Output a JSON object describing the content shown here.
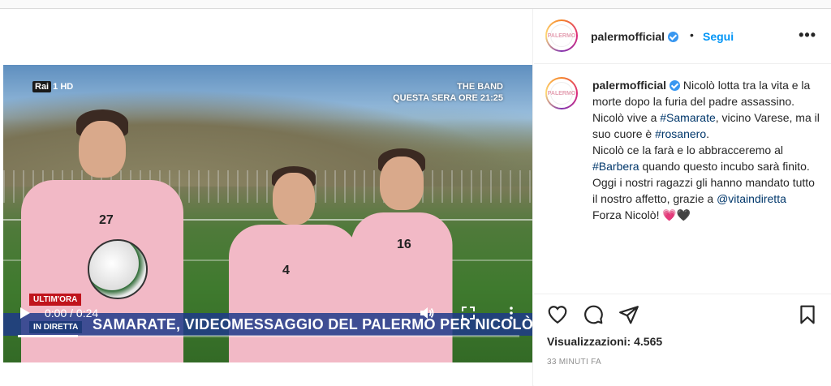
{
  "post": {
    "username": "palermofficial",
    "follow_label": "Segui",
    "separator": "•",
    "more_label": "•••",
    "avatar_text": "PALERMO"
  },
  "video": {
    "channel_logo": "Rai",
    "channel_num": "1",
    "channel_hd": "HD",
    "promo_line1": "THE BAND",
    "promo_line2": "QUESTA SERA ORE 21:25",
    "ticker_tag": "ULTIM'ORA",
    "ticker_live": "IN DIRETTA",
    "ticker_text": "SAMARATE, VIDEOMESSAGGIO DEL PALERMO PER NICOLÒ",
    "time_display": "0:00 / 0:24",
    "progress_fraction": 0.12,
    "player_numbers": [
      "27",
      "4",
      "16"
    ],
    "icons": [
      "play-icon",
      "volume-icon",
      "fullscreen-icon",
      "more-vertical-icon"
    ]
  },
  "caption": {
    "lines": [
      {
        "parts": [
          {
            "text": "Nicolò lotta tra la vita e la morte dopo la furia del padre assassino."
          }
        ]
      },
      {
        "parts": [
          {
            "text": "Nicolò vive a "
          },
          {
            "text": "#Samarate",
            "tag": true
          },
          {
            "text": ", vicino Varese, ma il suo cuore è "
          },
          {
            "text": "#rosanero",
            "tag": true
          },
          {
            "text": "."
          }
        ]
      },
      {
        "parts": [
          {
            "text": "Nicolò ce la farà e lo abbracceremo al "
          },
          {
            "text": "#Barbera",
            "tag": true
          },
          {
            "text": " quando questo incubo sarà finito."
          }
        ]
      },
      {
        "parts": [
          {
            "text": "Oggi i nostri ragazzi gli hanno mandato tutto il nostro affetto, grazie a "
          },
          {
            "text": "@vitaindiretta",
            "tag": true
          }
        ]
      },
      {
        "parts": [
          {
            "text": " "
          }
        ]
      },
      {
        "parts": [
          {
            "text": "Forza Nicolò! 💗🖤"
          }
        ]
      }
    ]
  },
  "stats": {
    "views_label": "Visualizzazioni:",
    "views_value": "4.565",
    "time_ago": "33 MINUTI FA"
  },
  "colors": {
    "link": "#0095f6",
    "hashtag": "#00376b",
    "verified": "#3897f0",
    "jersey": "#f2b9c6",
    "ticker_bg": "#1e3a8a",
    "ticker_tag_bg": "#c0141c"
  }
}
